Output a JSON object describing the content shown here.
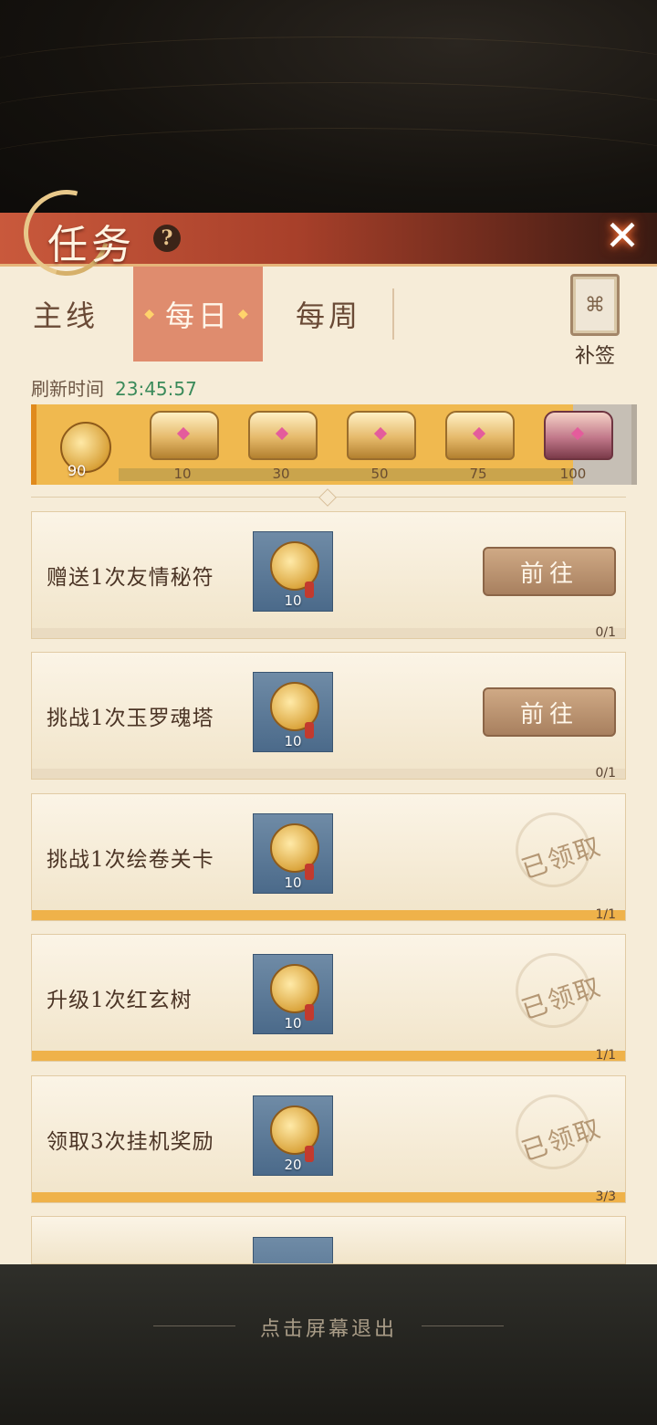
{
  "header": {
    "title": "任务",
    "help_icon": "?",
    "close_icon": "✕"
  },
  "tabs": [
    {
      "label": "主线",
      "active": false
    },
    {
      "label": "每日",
      "active": true
    },
    {
      "label": "每周",
      "active": false
    }
  ],
  "supplement": {
    "label": "补签",
    "icon": "scroll-icon"
  },
  "refresh": {
    "label": "刷新时间",
    "time": "23:45:57"
  },
  "activity": {
    "current": "90",
    "milestones": [
      "10",
      "30",
      "50",
      "75",
      "100"
    ]
  },
  "tasks": [
    {
      "name": "赠送1次友情秘符",
      "reward_qty": "10",
      "action": "前往",
      "claimed": false,
      "progress": "0/1",
      "fill": 0
    },
    {
      "name": "挑战1次玉罗魂塔",
      "reward_qty": "10",
      "action": "前往",
      "claimed": false,
      "progress": "0/1",
      "fill": 0
    },
    {
      "name": "挑战1次绘卷关卡",
      "reward_qty": "10",
      "action": "已领取",
      "claimed": true,
      "progress": "1/1",
      "fill": 1
    },
    {
      "name": "升级1次红玄树",
      "reward_qty": "10",
      "action": "已领取",
      "claimed": true,
      "progress": "1/1",
      "fill": 1
    },
    {
      "name": "领取3次挂机奖励",
      "reward_qty": "20",
      "action": "已领取",
      "claimed": true,
      "progress": "3/3",
      "fill": 1
    }
  ],
  "footer": {
    "exit_hint": "点击屏幕退出"
  }
}
